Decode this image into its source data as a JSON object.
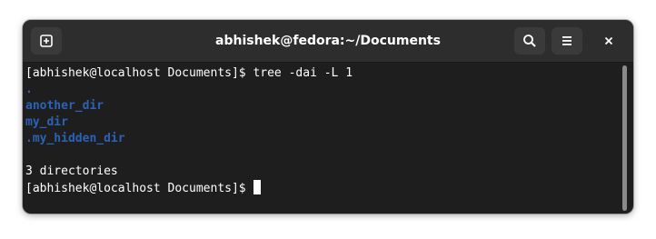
{
  "window": {
    "title": "abhishek@fedora:~/Documents"
  },
  "titlebar": {
    "new_tab_icon": "new-tab-icon",
    "search_icon": "search-icon",
    "menu_icon": "hamburger-menu-icon",
    "close_icon": "close-icon"
  },
  "terminal": {
    "lines": [
      {
        "text": "[abhishek@localhost Documents]$ tree -dai -L 1",
        "kind": "output"
      },
      {
        "text": ".",
        "kind": "dir"
      },
      {
        "text": "another_dir",
        "kind": "dir"
      },
      {
        "text": "my_dir",
        "kind": "dir"
      },
      {
        "text": ".my_hidden_dir",
        "kind": "dir"
      },
      {
        "text": "",
        "kind": "output"
      },
      {
        "text": "3 directories",
        "kind": "output"
      },
      {
        "text": "[abhishek@localhost Documents]$",
        "kind": "prompt"
      }
    ]
  },
  "colors": {
    "background": "#1e1e1e",
    "titlebar": "#2d2d2d",
    "directory": "#2a62b8",
    "text": "#ffffff"
  }
}
